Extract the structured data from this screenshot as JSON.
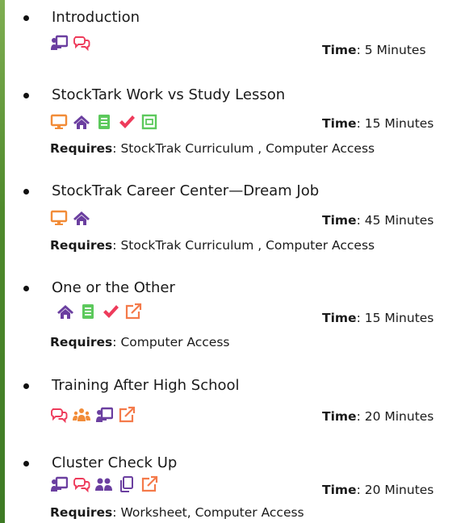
{
  "colors": {
    "purple": "#6b3fa0",
    "orange": "#f28c38",
    "green": "#5cc95c",
    "pink": "#ee3b5b",
    "coral": "#f47a4a"
  },
  "labels": {
    "time": "Time",
    "requires": "Requires"
  },
  "activities": [
    {
      "title": "Introduction",
      "icons": [
        "presentation-icon",
        "discussion-icon"
      ],
      "time": "5 Minutes",
      "requires": ""
    },
    {
      "title": "StockTark Work vs Study  Lesson",
      "icons": [
        "computer-icon",
        "home-icon",
        "book-icon",
        "check-icon",
        "worksheet-icon"
      ],
      "time": "15 Minutes",
      "requires": "StockTrak Curriculum , Computer Access"
    },
    {
      "title": "StockTrak Career Center—Dream Job",
      "icons": [
        "computer-icon",
        "home-icon"
      ],
      "time": "45 Minutes",
      "requires": "StockTrak Curriculum , Computer Access"
    },
    {
      "title": "One or the Other",
      "icons": [
        "home-icon",
        "book-icon",
        "check-icon",
        "external-link-icon"
      ],
      "time": "15 Minutes",
      "requires": "Computer Access"
    },
    {
      "title": "Training After High School",
      "icons": [
        "discussion-icon",
        "group-icon",
        "presentation-icon",
        "external-link-icon"
      ],
      "time": "20 Minutes",
      "requires": ""
    },
    {
      "title": "Cluster Check Up",
      "icons": [
        "presentation-icon",
        "discussion-icon",
        "pair-icon",
        "copy-icon",
        "external-link-icon"
      ],
      "time": "20 Minutes",
      "requires": "Worksheet,  Computer Access"
    }
  ]
}
